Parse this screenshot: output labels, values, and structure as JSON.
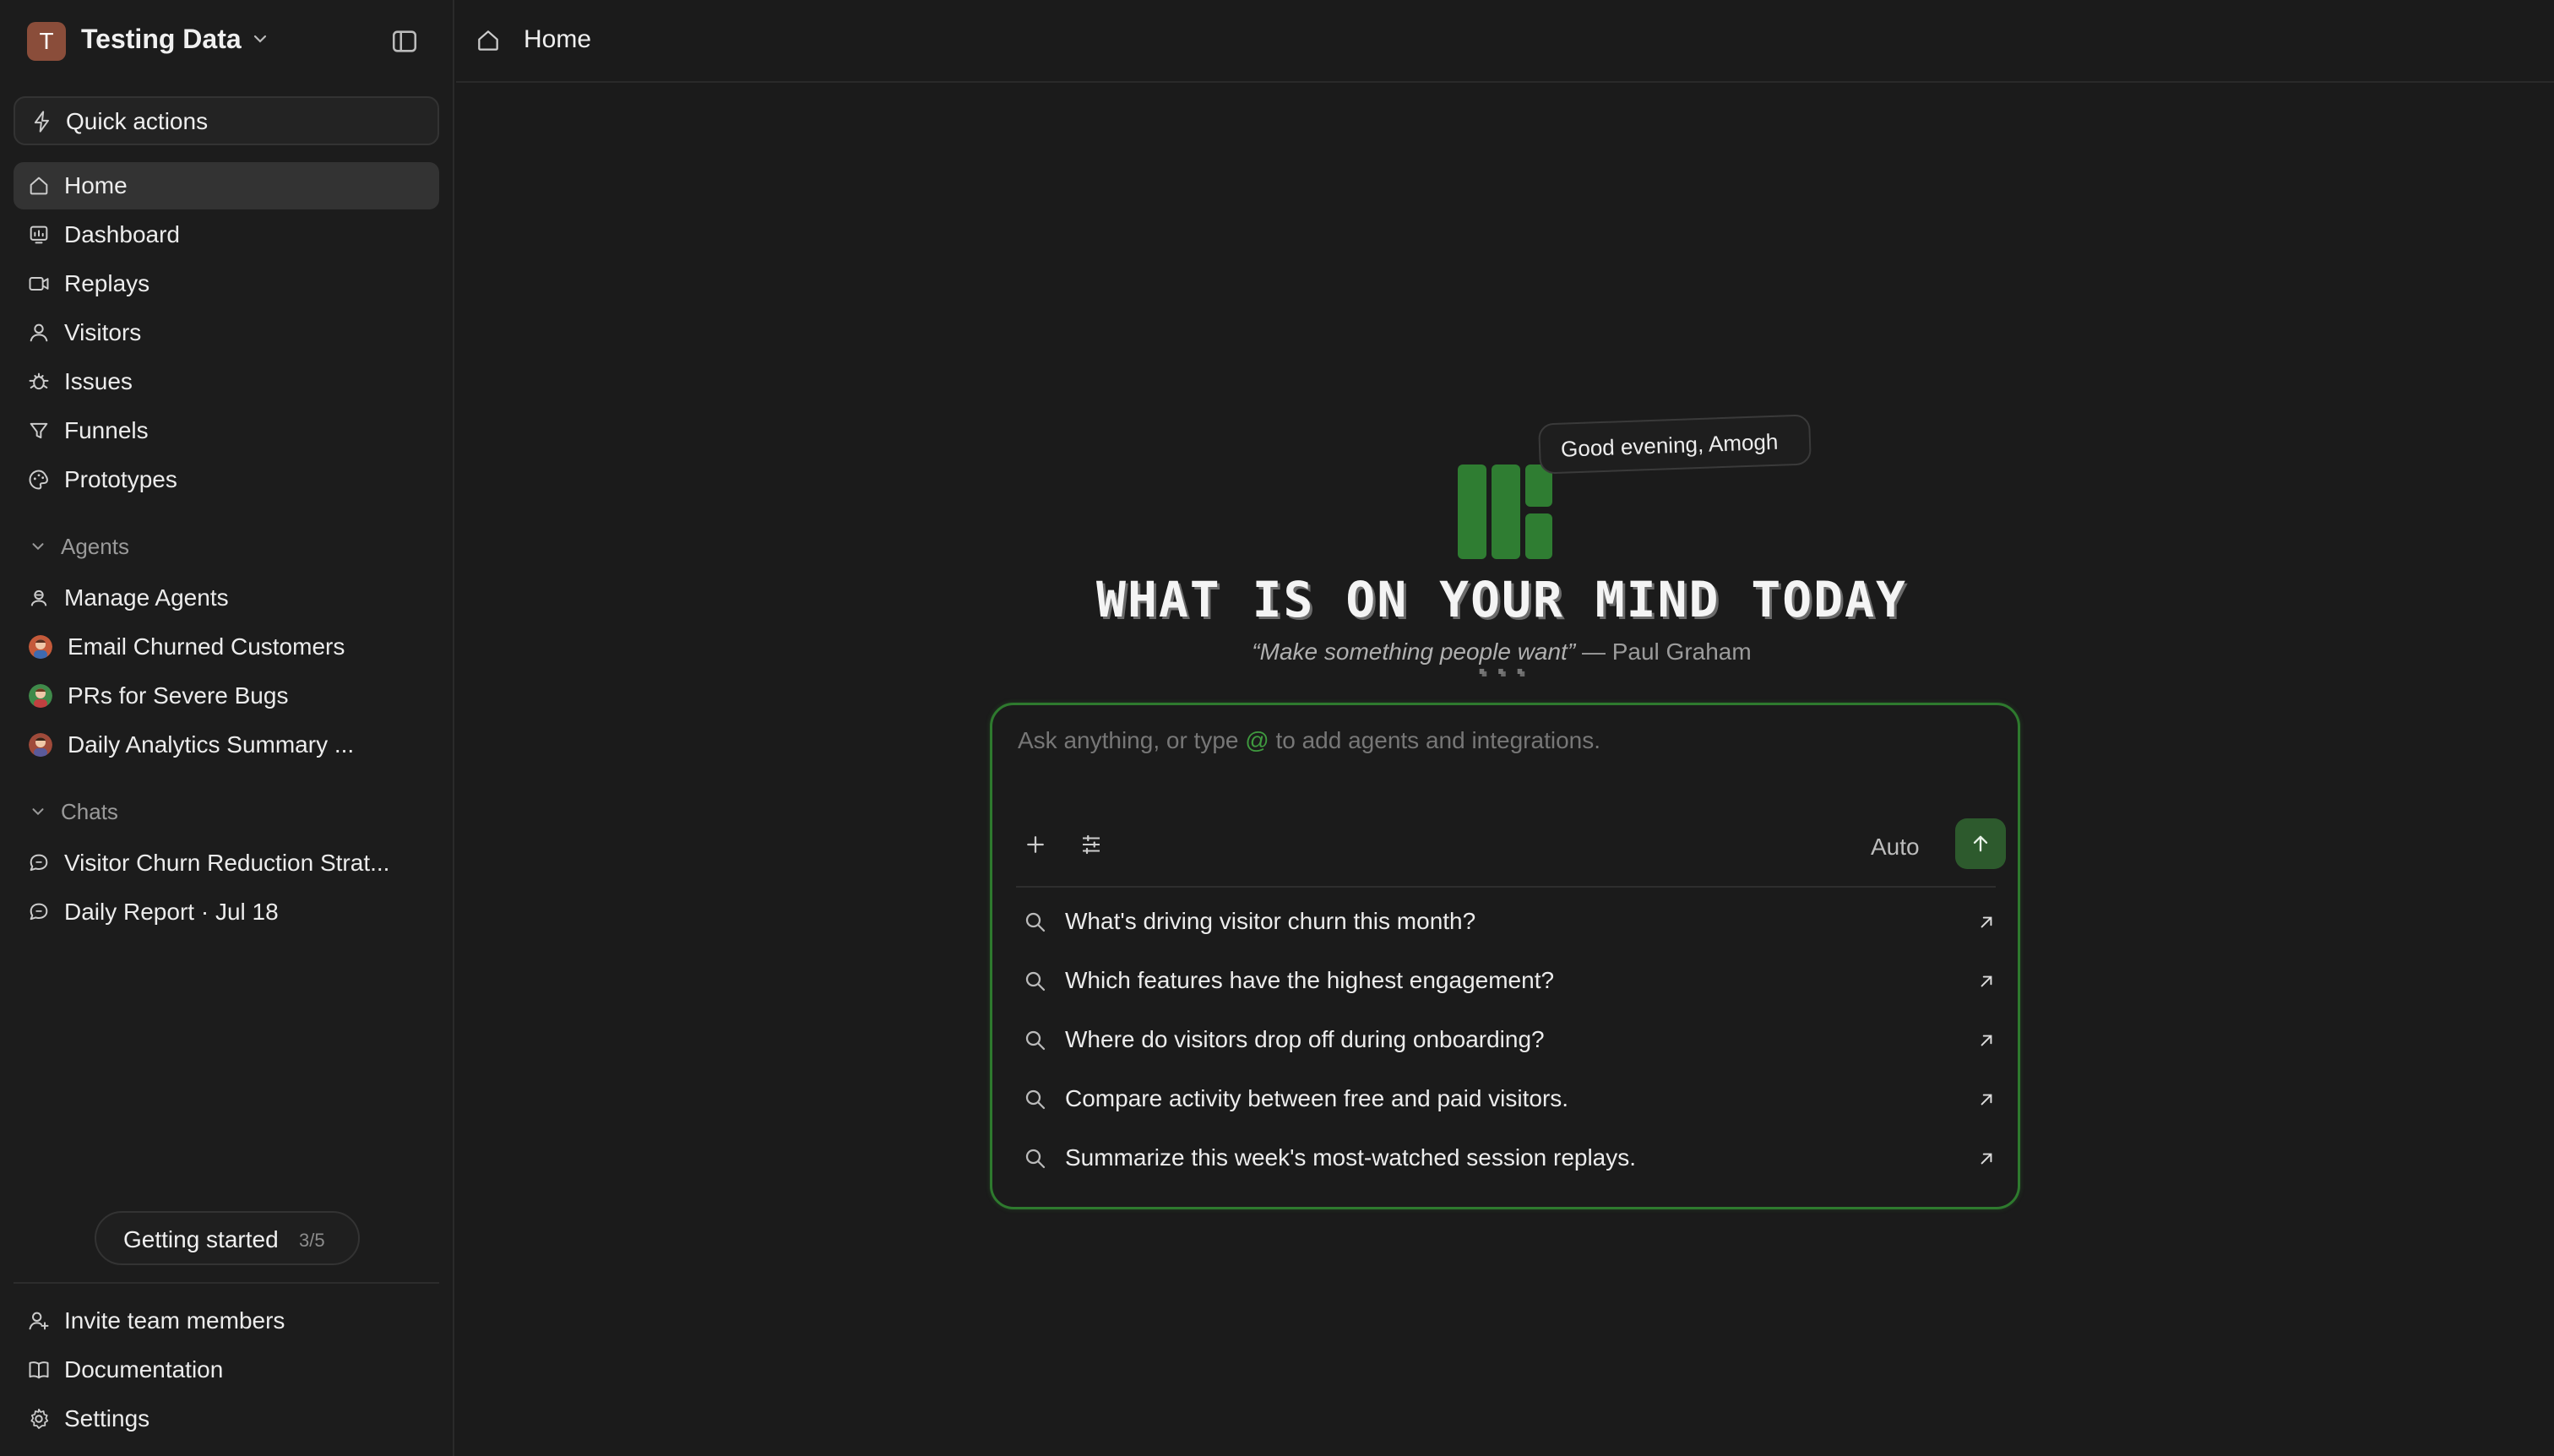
{
  "workspace": {
    "initial": "T",
    "name": "Testing Data"
  },
  "sidebar": {
    "quick_actions": "Quick actions",
    "nav": [
      {
        "label": "Home",
        "icon": "home-icon",
        "active": true
      },
      {
        "label": "Dashboard",
        "icon": "dashboard-icon"
      },
      {
        "label": "Replays",
        "icon": "video-icon"
      },
      {
        "label": "Visitors",
        "icon": "user-icon"
      },
      {
        "label": "Issues",
        "icon": "bug-icon"
      },
      {
        "label": "Funnels",
        "icon": "funnel-icon"
      },
      {
        "label": "Prototypes",
        "icon": "palette-icon"
      }
    ],
    "agents_section": {
      "title": "Agents",
      "items": [
        {
          "label": "Manage Agents",
          "icon": "agent-icon"
        },
        {
          "label": "Email Churned Customers",
          "icon": "agent-avatar"
        },
        {
          "label": "PRs for Severe Bugs",
          "icon": "agent-avatar"
        },
        {
          "label": "Daily Analytics Summary ...",
          "icon": "agent-avatar"
        }
      ]
    },
    "chats_section": {
      "title": "Chats",
      "items": [
        {
          "label": "Visitor Churn Reduction Strat...",
          "icon": "chat-icon"
        },
        {
          "label": "Daily Report · Jul 18",
          "icon": "chat-icon"
        }
      ]
    },
    "getting_started": {
      "label": "Getting started",
      "progress": "3/5"
    },
    "footer": [
      {
        "label": "Invite team members",
        "icon": "invite-icon"
      },
      {
        "label": "Documentation",
        "icon": "book-icon"
      },
      {
        "label": "Settings",
        "icon": "gear-icon"
      }
    ]
  },
  "topbar": {
    "title": "Home"
  },
  "main": {
    "greeting": "Good evening, Amogh",
    "headline": "WHAT IS ON YOUR MIND TODAY",
    "headline_dots": "...",
    "quote": {
      "text": "“Make something people want”",
      "author": "— Paul Graham"
    },
    "composer": {
      "placeholder_before": "Ask anything, or type ",
      "placeholder_at": "@",
      "placeholder_after": " to add agents and integrations.",
      "model": "Auto",
      "suggestions": [
        "What's driving visitor churn this month?",
        "Which features have the highest engagement?",
        "Where do visitors drop off during onboarding?",
        "Compare activity between free and paid visitors.",
        "Summarize this week's most-watched session replays."
      ]
    }
  },
  "colors": {
    "accent": "#2e7a2e",
    "logo": "#2f7d32",
    "send_bg": "#2d5a2d",
    "background": "#1b1b1b"
  }
}
